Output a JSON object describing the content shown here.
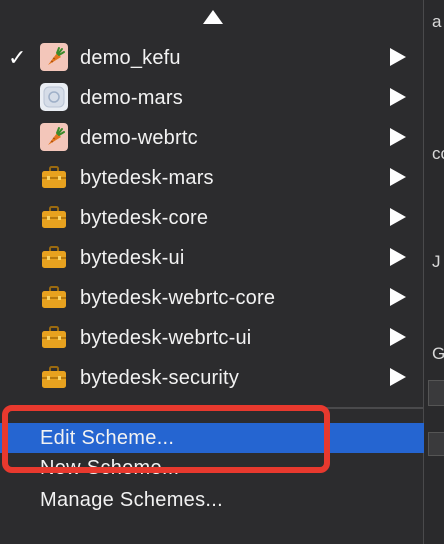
{
  "menu": {
    "schemes": [
      {
        "label": "demo_kefu",
        "icon": "carrot-icon",
        "checked": true
      },
      {
        "label": "demo-mars",
        "icon": "app-icon",
        "checked": false
      },
      {
        "label": "demo-webrtc",
        "icon": "carrot-icon",
        "checked": false
      },
      {
        "label": "bytedesk-mars",
        "icon": "toolbox-icon",
        "checked": false
      },
      {
        "label": "bytedesk-core",
        "icon": "toolbox-icon",
        "checked": false
      },
      {
        "label": "bytedesk-ui",
        "icon": "toolbox-icon",
        "checked": false
      },
      {
        "label": "bytedesk-webrtc-core",
        "icon": "toolbox-icon",
        "checked": false
      },
      {
        "label": "bytedesk-webrtc-ui",
        "icon": "toolbox-icon",
        "checked": false
      },
      {
        "label": "bytedesk-security",
        "icon": "toolbox-icon",
        "checked": false
      }
    ],
    "check_mark": "✓",
    "actions": {
      "edit_scheme": "Edit Scheme...",
      "new_scheme": "New Scheme...",
      "manage_schemes": "Manage Schemes..."
    },
    "colors": {
      "highlight": "#2565d1",
      "annotation": "#e8392e"
    }
  },
  "background": {
    "fragments": [
      "a",
      "co",
      "J",
      "G"
    ]
  }
}
